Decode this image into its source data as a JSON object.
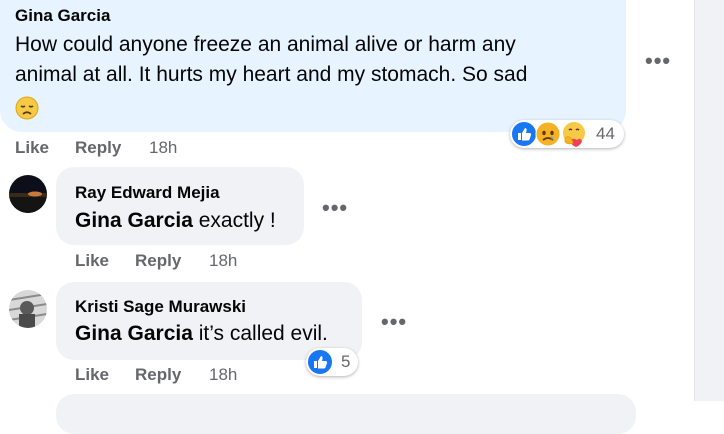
{
  "main_comment": {
    "author": "Gina Garcia",
    "text_line1": "How could anyone freeze an animal alive or harm any",
    "text_line2": "animal at all. It hurts my heart and my stomach. So sad",
    "emoji": "disappointed-face",
    "reaction_count": "44",
    "reaction_icons": [
      "like-icon",
      "sad-icon",
      "care-icon"
    ],
    "actions": {
      "like": "Like",
      "reply": "Reply",
      "time": "18h"
    }
  },
  "replies": [
    {
      "author": "Ray Edward Mejia",
      "mention": "Gina Garcia",
      "text": " exactly !",
      "actions": {
        "like": "Like",
        "reply": "Reply",
        "time": "18h"
      }
    },
    {
      "author": "Kristi Sage Murawski",
      "mention": "Gina Garcia",
      "text": " it’s called evil.",
      "reaction_count": "5",
      "reaction_icons": [
        "like-icon"
      ],
      "actions": {
        "like": "Like",
        "reply": "Reply",
        "time": "18h"
      }
    }
  ],
  "colors": {
    "main_bubble": "#e7f3ff",
    "reply_bubble": "#f0f2f5",
    "secondary_text": "#65676b",
    "like_blue": "#1877f2"
  }
}
